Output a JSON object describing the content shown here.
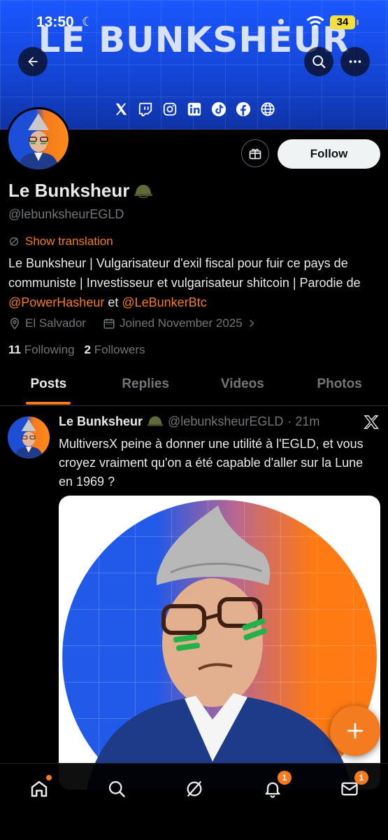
{
  "status_bar": {
    "time": "13:50",
    "battery": "34"
  },
  "banner": {
    "title": "LE BUNKSHEUR",
    "socials": [
      "x-icon",
      "twitch-icon",
      "instagram-icon",
      "linkedin-icon",
      "tiktok-icon",
      "facebook-icon",
      "globe-icon"
    ]
  },
  "profile": {
    "name": "Le Bunksheur",
    "handle": "@lebunksheurEGLD",
    "show_translation": "Show translation",
    "bio_text": "Le Bunksheur | Vulgarisateur d'exil fiscal pour fuir ce pays de communiste | Investisseur et vulgarisateur shitcoin | Parodie de ",
    "bio_mention_1": "@PowerHasheur",
    "bio_and": " et ",
    "bio_mention_2": "@LeBunkerBtc",
    "location": "El Salvador",
    "joined": "Joined November 2025",
    "following_count": "11",
    "following_label": "Following",
    "followers_count": "2",
    "followers_label": "Followers",
    "follow_button": "Follow"
  },
  "tabs": [
    {
      "label": "Posts",
      "active": true
    },
    {
      "label": "Replies",
      "active": false
    },
    {
      "label": "Videos",
      "active": false
    },
    {
      "label": "Photos",
      "active": false
    }
  ],
  "post": {
    "author": "Le Bunksheur",
    "handle": "@lebunksheurEGLD",
    "time": "· 21m",
    "text": "MultiversX peine à donner une utilité à l'EGLD, et vous croyez vraiment qu'on a été capable d'aller sur la Lune en 1969 ?"
  },
  "bottom_nav": {
    "notifications_badge": "1",
    "messages_badge": "1"
  },
  "colors": {
    "accent": "#f47b1f",
    "banner_blue": "#1b57ff",
    "text_secondary": "#71767b"
  }
}
